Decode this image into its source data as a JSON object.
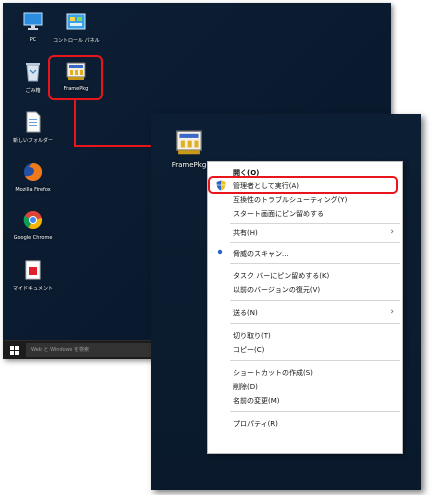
{
  "desktop_icons": {
    "pc": "PC",
    "control_panel": "コントロール パネル",
    "recycle_bin": "ごみ箱",
    "framepkg": "FramePkg",
    "new_folder": "新しいフォルダー",
    "firefox": "Mozilla Firefox",
    "chrome": "Google Chrome",
    "my_documents": "マイドキュメント"
  },
  "taskbar": {
    "search_placeholder": "Web と Windows を検索"
  },
  "zoom": {
    "framepkg_label": "FramePkg"
  },
  "context_menu": {
    "open": "開く(O)",
    "run_as_admin": "管理者として実行(A)",
    "troubleshoot": "互換性のトラブルシューティング(Y)",
    "pin_start": "スタート画面にピン留めする",
    "share": "共有(H)",
    "scan": "脅威のスキャン...",
    "pin_taskbar": "タスク バーにピン留めする(K)",
    "restore": "以前のバージョンの復元(V)",
    "send_to": "送る(N)",
    "cut": "切り取り(T)",
    "copy": "コピー(C)",
    "create_shortcut": "ショートカットの作成(S)",
    "delete": "削除(D)",
    "rename": "名前の変更(M)",
    "properties": "プロパティ(R)"
  },
  "colors": {
    "highlight": "#e8161b",
    "desktop_bg": "#0b1b2f",
    "menu_bg": "#ffffff"
  }
}
